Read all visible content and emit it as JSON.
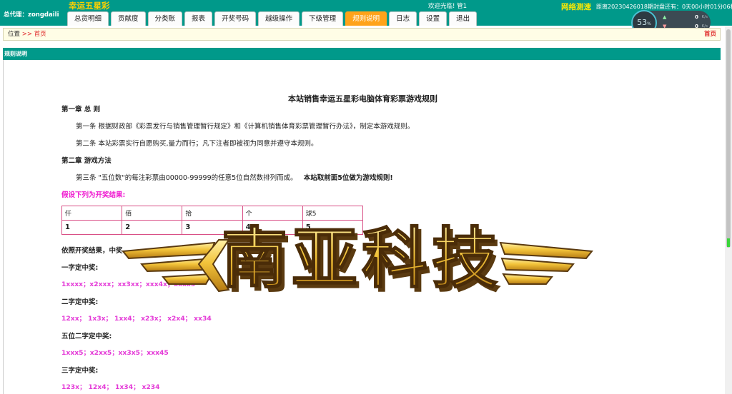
{
  "header": {
    "agent_label": "总代理：zongdaili",
    "brand": "幸运五星彩",
    "welcome": "欢迎光临! 管1",
    "net_test": "网络测速",
    "countdown": "距离20230426018期封盘还有：0天00小时01分06秒"
  },
  "tabs": [
    {
      "label": "总货明细",
      "active": false
    },
    {
      "label": "贡献度",
      "active": false
    },
    {
      "label": "分类账",
      "active": false
    },
    {
      "label": "报表",
      "active": false
    },
    {
      "label": "开奖号码",
      "active": false
    },
    {
      "label": "越级操作",
      "active": false
    },
    {
      "label": "下级管理",
      "active": false
    },
    {
      "label": "规则说明",
      "active": true
    },
    {
      "label": "日志",
      "active": false
    },
    {
      "label": "设置",
      "active": false
    },
    {
      "label": "退出",
      "active": false
    }
  ],
  "speed_widget": {
    "percent": "53",
    "percent_unit": "%",
    "upload_value": "0",
    "download_value": "0",
    "unit": "K/s"
  },
  "breadcrumb": {
    "position_label": "位置",
    "separator": ">>",
    "home": "首页",
    "right_home": "首页"
  },
  "section_title": "规则说明",
  "doc": {
    "title": "本站销售幸运五星彩电脑体育彩票游戏规则",
    "chapter1": "第一章 总 则",
    "article1": "第一条 根据财政部《彩票发行与销售管理暂行规定》和《计算机销售体育彩票管理暂行办法》，制定本游戏规则。",
    "article2": "第二条 本站彩票实行自愿购买,量力而行；凡下注者即被视为同意并遵守本规则。",
    "chapter2": "第二章 游戏方法",
    "article3_prefix": "第三条 \"五位数\"的每注彩票由00000-99999的任意5位自然数排列而成。",
    "article3_bold": "本站取前面5位做为游戏规则!",
    "assume_heading": "假设下列为开奖结果:",
    "table_headers": [
      "仟",
      "佰",
      "拾",
      "个",
      "球5"
    ],
    "table_values": [
      "1",
      "2",
      "3",
      "4",
      "5"
    ],
    "basis_text": "依照开奖结果，中奖",
    "one_digit_heading": "一字定中奖:",
    "one_digit_examples": "1xxxx；x2xxx；xx3xx；xxx4x；xxxx5",
    "two_digit_heading": "二字定中奖:",
    "two_digit_examples": "12xx； 1x3x； 1xx4； x23x； x2x4； xx34",
    "five_two_heading": "五位二字定中奖:",
    "five_two_examples": "1xxx5；x2xx5；xx3x5；xxx45",
    "three_digit_heading": "三字定中奖:",
    "three_digit_examples": "123x； 12x4； 1x34； x234"
  },
  "watermark": {
    "text": "南亚科技",
    "colors": {
      "gold": "#f2c33a",
      "shadow": "#5a3a10"
    }
  },
  "colors": {
    "primary": "#00998a",
    "active_tab": "#ffa31a",
    "brand": "#ffd100",
    "link_red": "#e02b2b",
    "magenta": "#e43ad7"
  }
}
